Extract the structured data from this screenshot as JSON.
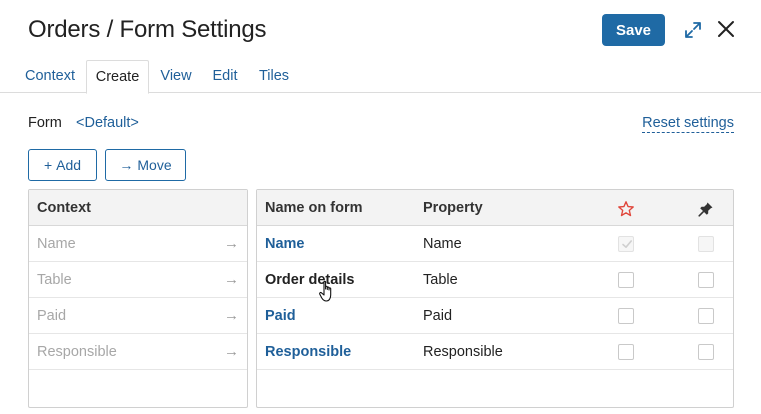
{
  "header": {
    "title": "Orders / Form Settings",
    "save_label": "Save",
    "icons": [
      "expand-icon",
      "close-icon"
    ]
  },
  "tabs": [
    {
      "label": "Context",
      "active": false
    },
    {
      "label": "Create",
      "active": true
    },
    {
      "label": "View",
      "active": false
    },
    {
      "label": "Edit",
      "active": false
    },
    {
      "label": "Tiles",
      "active": false
    }
  ],
  "form": {
    "label": "Form",
    "value": "<Default>",
    "reset_label": "Reset settings"
  },
  "toolbar": {
    "add_glyph": "+",
    "add_label": "Add",
    "move_glyph": "→",
    "move_label": "Move"
  },
  "context_panel": {
    "header": "Context",
    "items": [
      {
        "name": "Name",
        "arrow": "→"
      },
      {
        "name": "Table",
        "arrow": "→"
      },
      {
        "name": "Paid",
        "arrow": "→"
      },
      {
        "name": "Responsible",
        "arrow": "→"
      }
    ]
  },
  "form_panel": {
    "headers": {
      "name": "Name on form",
      "property": "Property"
    },
    "header_icons": [
      "star-icon",
      "pin-icon"
    ],
    "rows": [
      {
        "name": "Name",
        "property": "Name",
        "required": true,
        "required_disabled": true,
        "pinned": false,
        "pinned_disabled": true,
        "link": true
      },
      {
        "name": "Order details",
        "property": "Table",
        "required": false,
        "required_disabled": false,
        "pinned": false,
        "pinned_disabled": false,
        "link": false
      },
      {
        "name": "Paid",
        "property": "Paid",
        "required": false,
        "required_disabled": false,
        "pinned": false,
        "pinned_disabled": false,
        "link": true
      },
      {
        "name": "Responsible",
        "property": "Responsible",
        "required": false,
        "required_disabled": false,
        "pinned": false,
        "pinned_disabled": false,
        "link": true
      }
    ]
  },
  "colors": {
    "accent": "#1f6aa5",
    "link": "#1f5f99",
    "star": "#e0473c"
  }
}
